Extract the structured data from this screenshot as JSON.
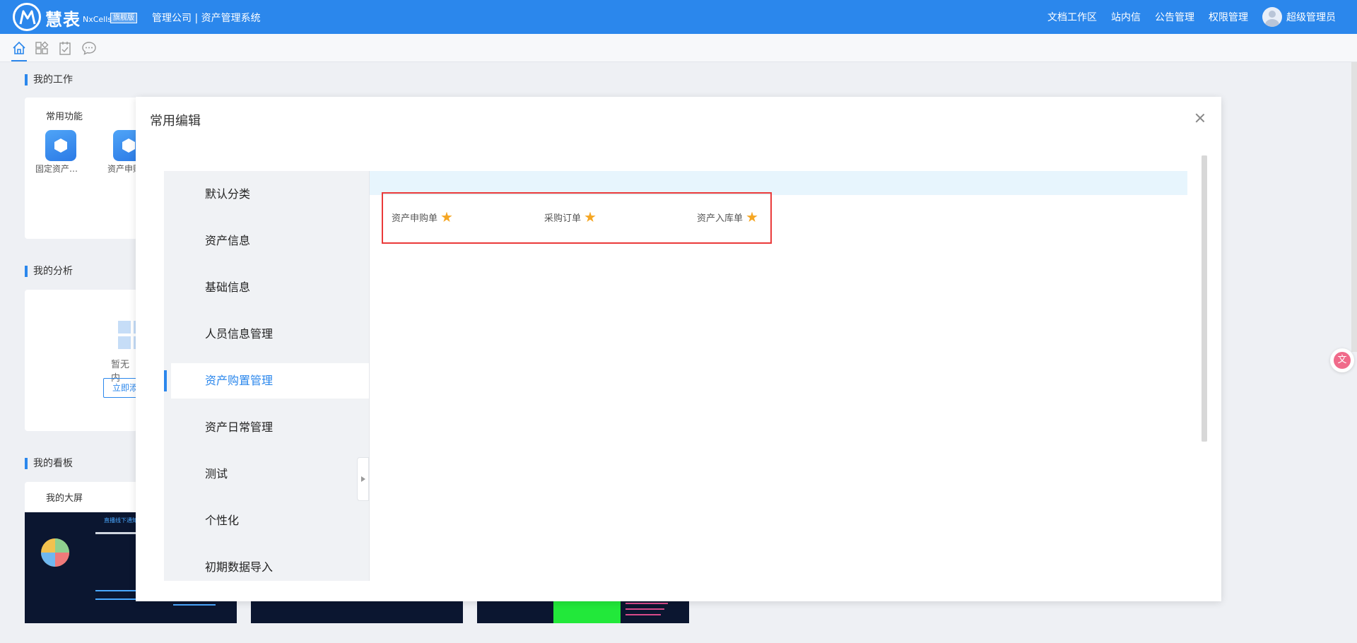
{
  "header": {
    "brand": "慧表",
    "brand_sub": "NxCells",
    "brand_badge": "旗舰版",
    "company": "管理公司 | 资产管理系统",
    "nav": [
      "文档工作区",
      "站内信",
      "公告管理",
      "权限管理"
    ],
    "user_name": "超级管理员"
  },
  "dashboard": {
    "work_title": "我的工作",
    "common_label": "常用功能",
    "apps": [
      "固定资产…",
      "资产申购"
    ],
    "analysis_title": "我的分析",
    "empty_text": "暂无内",
    "add_button": "立即添",
    "board_title": "我的看板",
    "screen_label": "我的大屏",
    "thumb_title": "直播线下通知"
  },
  "modal": {
    "title": "常用编辑",
    "categories": [
      "默认分类",
      "资产信息",
      "基础信息",
      "人员信息管理",
      "资产购置管理",
      "资产日常管理",
      "测试",
      "个性化",
      "初期数据导入"
    ],
    "active_category": "资产购置管理",
    "functions": [
      "资产申购单",
      "采购订单",
      "资产入库单"
    ]
  },
  "colors": {
    "primary": "#2b87ec",
    "highlight_border": "#ea3a3a",
    "star": "#f5a623"
  },
  "icons": {
    "translate": "文"
  }
}
